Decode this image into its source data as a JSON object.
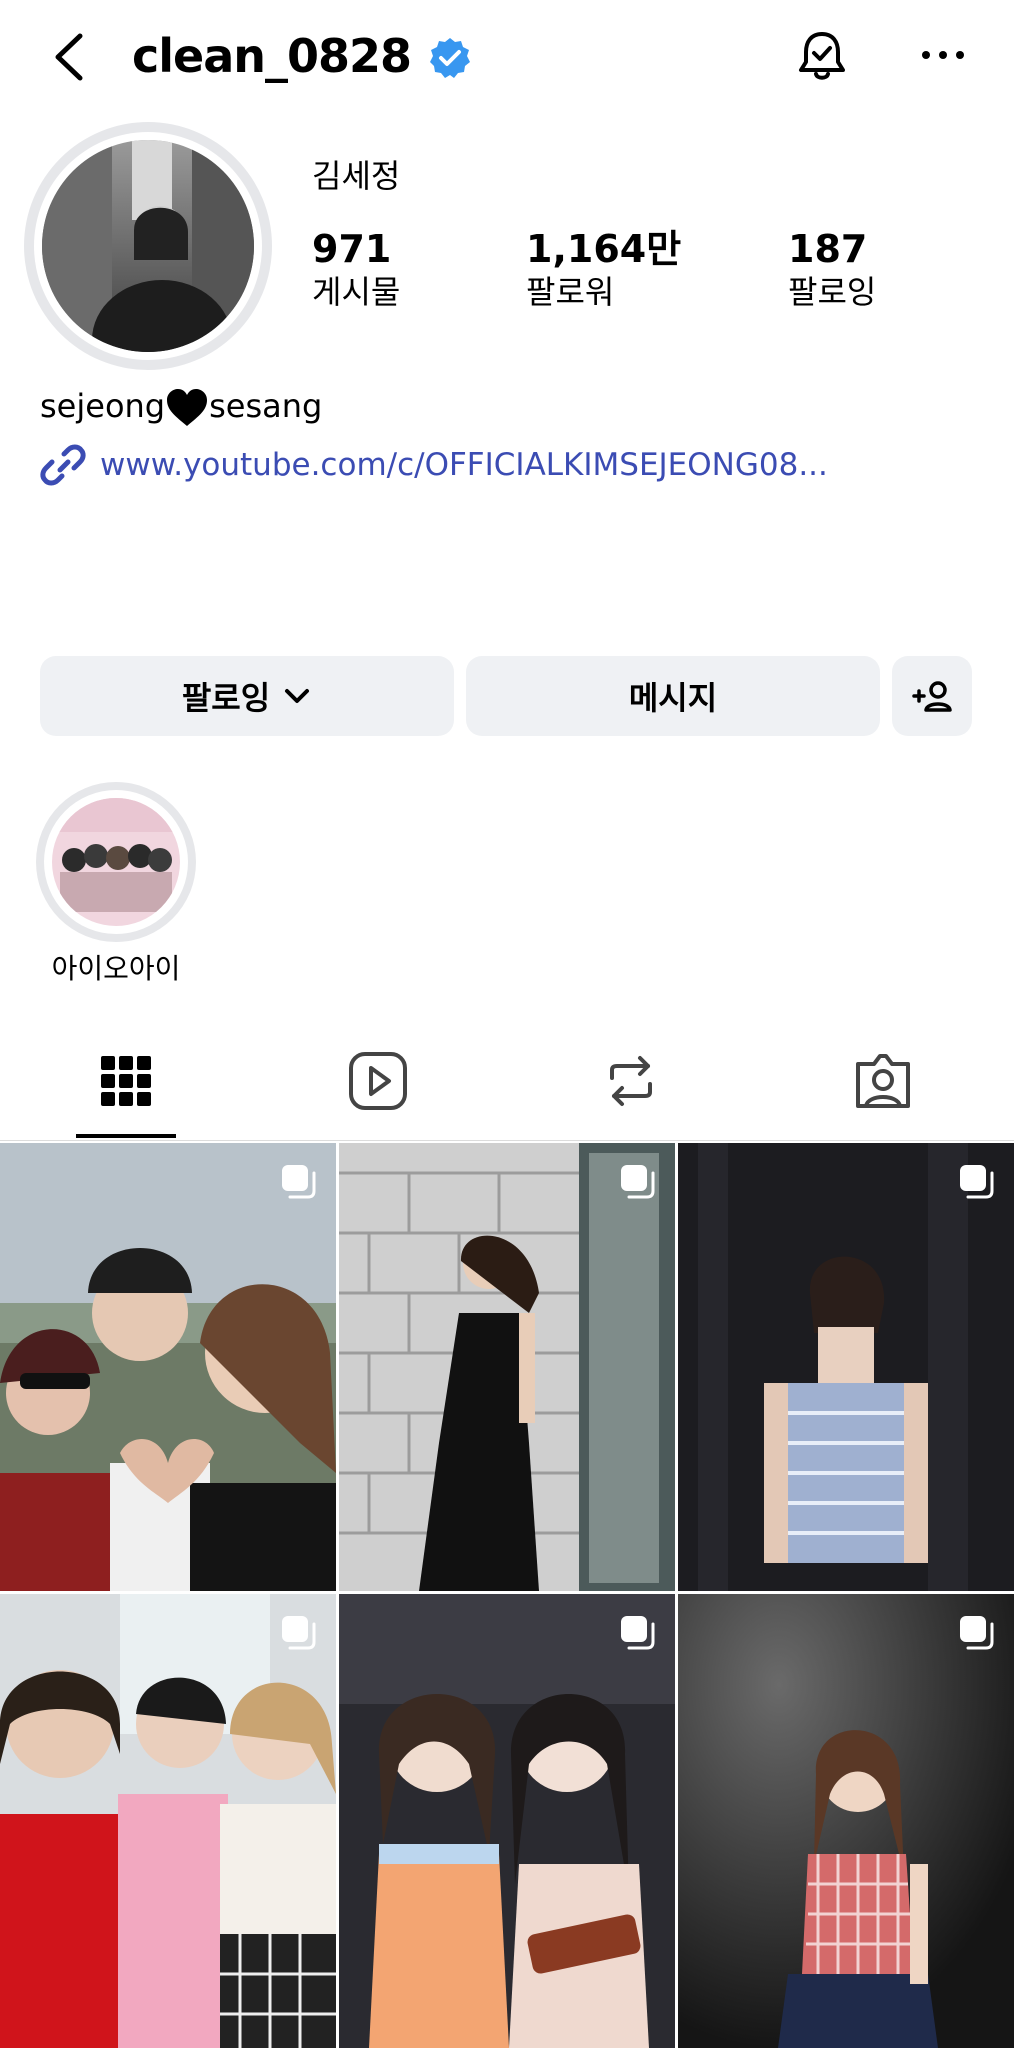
{
  "header": {
    "username": "clean_0828",
    "verified": true,
    "accent": "#3897f0"
  },
  "profile": {
    "name": "김세정",
    "stats": [
      {
        "value": "971",
        "label": "게시물"
      },
      {
        "value": "1,164만",
        "label": "팔로워"
      },
      {
        "value": "187",
        "label": "팔로잉"
      }
    ],
    "bio_before": "sejeong",
    "bio_after": "sesang",
    "link": "www.youtube.com/c/OFFICIALKIMSEJEONG08..."
  },
  "actions": {
    "follow_label": "팔로잉",
    "message_label": "메시지",
    "add_label": "+person-icon"
  },
  "highlights": [
    {
      "label": "아이오아이"
    }
  ],
  "tabs": [
    {
      "icon": "grid-icon",
      "active": true
    },
    {
      "icon": "reels-icon",
      "active": false
    },
    {
      "icon": "repost-icon",
      "active": false
    },
    {
      "icon": "tagged-icon",
      "active": false
    }
  ],
  "posts": [
    {
      "kind": "carousel"
    },
    {
      "kind": "carousel"
    },
    {
      "kind": "carousel"
    },
    {
      "kind": "carousel"
    },
    {
      "kind": "carousel"
    },
    {
      "kind": "carousel"
    }
  ],
  "colors": {
    "link": "#3b4cb3",
    "button_bg": "#eff1f4"
  }
}
